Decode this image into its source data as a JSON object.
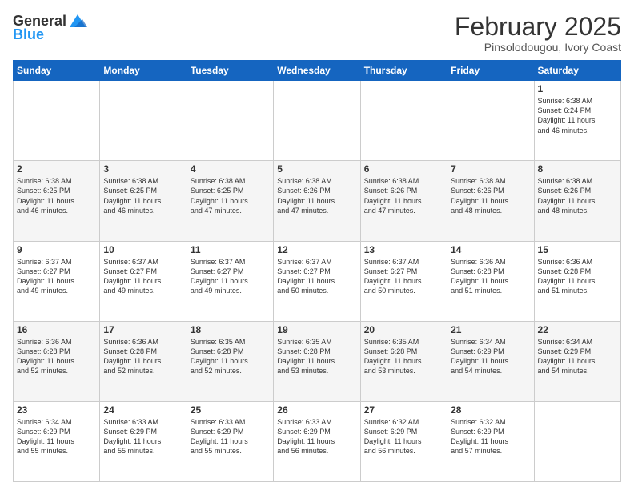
{
  "logo": {
    "line1": "General",
    "line2": "Blue"
  },
  "title": "February 2025",
  "subtitle": "Pinsolodougou, Ivory Coast",
  "weekdays": [
    "Sunday",
    "Monday",
    "Tuesday",
    "Wednesday",
    "Thursday",
    "Friday",
    "Saturday"
  ],
  "weeks": [
    [
      {
        "day": "",
        "info": ""
      },
      {
        "day": "",
        "info": ""
      },
      {
        "day": "",
        "info": ""
      },
      {
        "day": "",
        "info": ""
      },
      {
        "day": "",
        "info": ""
      },
      {
        "day": "",
        "info": ""
      },
      {
        "day": "1",
        "info": "Sunrise: 6:38 AM\nSunset: 6:24 PM\nDaylight: 11 hours\nand 46 minutes."
      }
    ],
    [
      {
        "day": "2",
        "info": "Sunrise: 6:38 AM\nSunset: 6:25 PM\nDaylight: 11 hours\nand 46 minutes."
      },
      {
        "day": "3",
        "info": "Sunrise: 6:38 AM\nSunset: 6:25 PM\nDaylight: 11 hours\nand 46 minutes."
      },
      {
        "day": "4",
        "info": "Sunrise: 6:38 AM\nSunset: 6:25 PM\nDaylight: 11 hours\nand 47 minutes."
      },
      {
        "day": "5",
        "info": "Sunrise: 6:38 AM\nSunset: 6:26 PM\nDaylight: 11 hours\nand 47 minutes."
      },
      {
        "day": "6",
        "info": "Sunrise: 6:38 AM\nSunset: 6:26 PM\nDaylight: 11 hours\nand 47 minutes."
      },
      {
        "day": "7",
        "info": "Sunrise: 6:38 AM\nSunset: 6:26 PM\nDaylight: 11 hours\nand 48 minutes."
      },
      {
        "day": "8",
        "info": "Sunrise: 6:38 AM\nSunset: 6:26 PM\nDaylight: 11 hours\nand 48 minutes."
      }
    ],
    [
      {
        "day": "9",
        "info": "Sunrise: 6:37 AM\nSunset: 6:27 PM\nDaylight: 11 hours\nand 49 minutes."
      },
      {
        "day": "10",
        "info": "Sunrise: 6:37 AM\nSunset: 6:27 PM\nDaylight: 11 hours\nand 49 minutes."
      },
      {
        "day": "11",
        "info": "Sunrise: 6:37 AM\nSunset: 6:27 PM\nDaylight: 11 hours\nand 49 minutes."
      },
      {
        "day": "12",
        "info": "Sunrise: 6:37 AM\nSunset: 6:27 PM\nDaylight: 11 hours\nand 50 minutes."
      },
      {
        "day": "13",
        "info": "Sunrise: 6:37 AM\nSunset: 6:27 PM\nDaylight: 11 hours\nand 50 minutes."
      },
      {
        "day": "14",
        "info": "Sunrise: 6:36 AM\nSunset: 6:28 PM\nDaylight: 11 hours\nand 51 minutes."
      },
      {
        "day": "15",
        "info": "Sunrise: 6:36 AM\nSunset: 6:28 PM\nDaylight: 11 hours\nand 51 minutes."
      }
    ],
    [
      {
        "day": "16",
        "info": "Sunrise: 6:36 AM\nSunset: 6:28 PM\nDaylight: 11 hours\nand 52 minutes."
      },
      {
        "day": "17",
        "info": "Sunrise: 6:36 AM\nSunset: 6:28 PM\nDaylight: 11 hours\nand 52 minutes."
      },
      {
        "day": "18",
        "info": "Sunrise: 6:35 AM\nSunset: 6:28 PM\nDaylight: 11 hours\nand 52 minutes."
      },
      {
        "day": "19",
        "info": "Sunrise: 6:35 AM\nSunset: 6:28 PM\nDaylight: 11 hours\nand 53 minutes."
      },
      {
        "day": "20",
        "info": "Sunrise: 6:35 AM\nSunset: 6:28 PM\nDaylight: 11 hours\nand 53 minutes."
      },
      {
        "day": "21",
        "info": "Sunrise: 6:34 AM\nSunset: 6:29 PM\nDaylight: 11 hours\nand 54 minutes."
      },
      {
        "day": "22",
        "info": "Sunrise: 6:34 AM\nSunset: 6:29 PM\nDaylight: 11 hours\nand 54 minutes."
      }
    ],
    [
      {
        "day": "23",
        "info": "Sunrise: 6:34 AM\nSunset: 6:29 PM\nDaylight: 11 hours\nand 55 minutes."
      },
      {
        "day": "24",
        "info": "Sunrise: 6:33 AM\nSunset: 6:29 PM\nDaylight: 11 hours\nand 55 minutes."
      },
      {
        "day": "25",
        "info": "Sunrise: 6:33 AM\nSunset: 6:29 PM\nDaylight: 11 hours\nand 55 minutes."
      },
      {
        "day": "26",
        "info": "Sunrise: 6:33 AM\nSunset: 6:29 PM\nDaylight: 11 hours\nand 56 minutes."
      },
      {
        "day": "27",
        "info": "Sunrise: 6:32 AM\nSunset: 6:29 PM\nDaylight: 11 hours\nand 56 minutes."
      },
      {
        "day": "28",
        "info": "Sunrise: 6:32 AM\nSunset: 6:29 PM\nDaylight: 11 hours\nand 57 minutes."
      },
      {
        "day": "",
        "info": ""
      }
    ]
  ]
}
